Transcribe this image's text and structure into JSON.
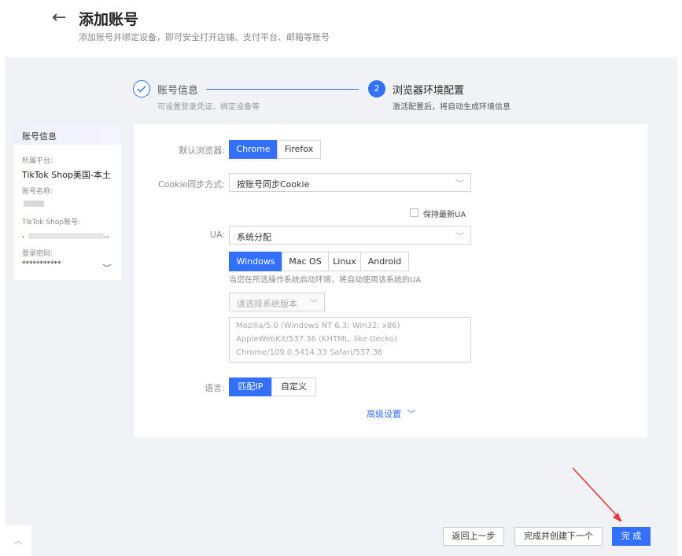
{
  "header": {
    "back_icon": "arrow-left-icon",
    "title": "添加账号",
    "subtitle": "添加账号并绑定设备，即可安全打开店铺、支付平台、邮箱等账号"
  },
  "steps": [
    {
      "label": "账号信息",
      "desc": "可设置登录凭证、绑定设备等",
      "state": "done"
    },
    {
      "number": "2",
      "label": "浏览器环境配置",
      "desc": "激活配置后，将自动生成环境信息",
      "state": "active"
    }
  ],
  "sidebar": {
    "heading": "账号信息",
    "platform_label": "所属平台:",
    "platform_value": "TikTok Shop美国-本土",
    "name_label": "账号名称:",
    "account_label": "TikTok Shop账号:",
    "account_prefix": ".",
    "account_suffix": "..",
    "password_label": "登录密码:",
    "password_value": "***********"
  },
  "form": {
    "browser": {
      "label": "默认浏览器:",
      "options": [
        "Chrome",
        "Firefox"
      ],
      "selected": "Chrome"
    },
    "cookie": {
      "label": "Cookie同步方式:",
      "value": "按账号同步Cookie"
    },
    "keep_latest_ua": {
      "label": "保持最新UA",
      "checked": false
    },
    "ua": {
      "label": "UA:",
      "value": "系统分配"
    },
    "os": {
      "options": [
        "Windows",
        "Mac OS",
        "Linux",
        "Android"
      ],
      "selected": "Windows"
    },
    "os_hint": "当您在所选操作系统启动环境，将自动使用该系统的UA",
    "version_select": {
      "placeholder": "请选择系统版本"
    },
    "ua_string_lines": [
      "Mozilla/5.0 (Windows NT 6.3; Win32; x86)",
      "AppleWebKit/537.36 (KHTML, like Gecko)",
      "Chrome/109.0.5414.33 Safari/537.36"
    ],
    "language": {
      "label": "语言:",
      "options": [
        "匹配IP",
        "自定义"
      ],
      "selected": "匹配IP"
    },
    "advanced": "高级设置"
  },
  "footer": {
    "prev": "返回上一步",
    "finish_next": "完成并创建下一个",
    "finish": "完 成"
  },
  "colors": {
    "accent": "#3370ff",
    "annotation_arrow": "#e53935"
  }
}
